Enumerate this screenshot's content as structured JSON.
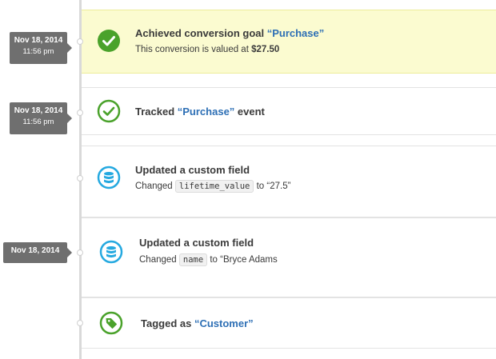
{
  "events": [
    {
      "date": "Nov 18, 2014",
      "time": "11:56 pm",
      "title_prefix": "Achieved conversion goal ",
      "title_quoted": "“Purchase”",
      "detail_prefix": "This conversion is valued at ",
      "detail_value": "$27.50"
    },
    {
      "date": "Nov 18, 2014",
      "time": "11:56 pm",
      "title_prefix": "Tracked ",
      "title_quoted": "“Purchase”",
      "title_suffix": " event"
    },
    {
      "title": "Updated a custom field",
      "detail_prefix": "Changed ",
      "detail_code": "lifetime_value",
      "detail_suffix": " to “27.5”"
    },
    {
      "date": "Nov 18, 2014",
      "title": "Updated a custom field",
      "detail_prefix": "Changed ",
      "detail_code": "name",
      "detail_suffix": " to “Bryce Adams"
    },
    {
      "title_prefix": "Tagged as ",
      "title_quoted": "“Customer”"
    }
  ],
  "icons": {
    "conversion": "check-circle-filled-icon",
    "event": "check-circle-outline-icon",
    "field": "database-icon",
    "tag": "tag-icon"
  },
  "colors": {
    "green": "#4aa22b",
    "blue": "#25a9e0",
    "link": "#2d6fb5",
    "highlight": "#fbfbd0",
    "stamp": "#6f6f6f"
  }
}
